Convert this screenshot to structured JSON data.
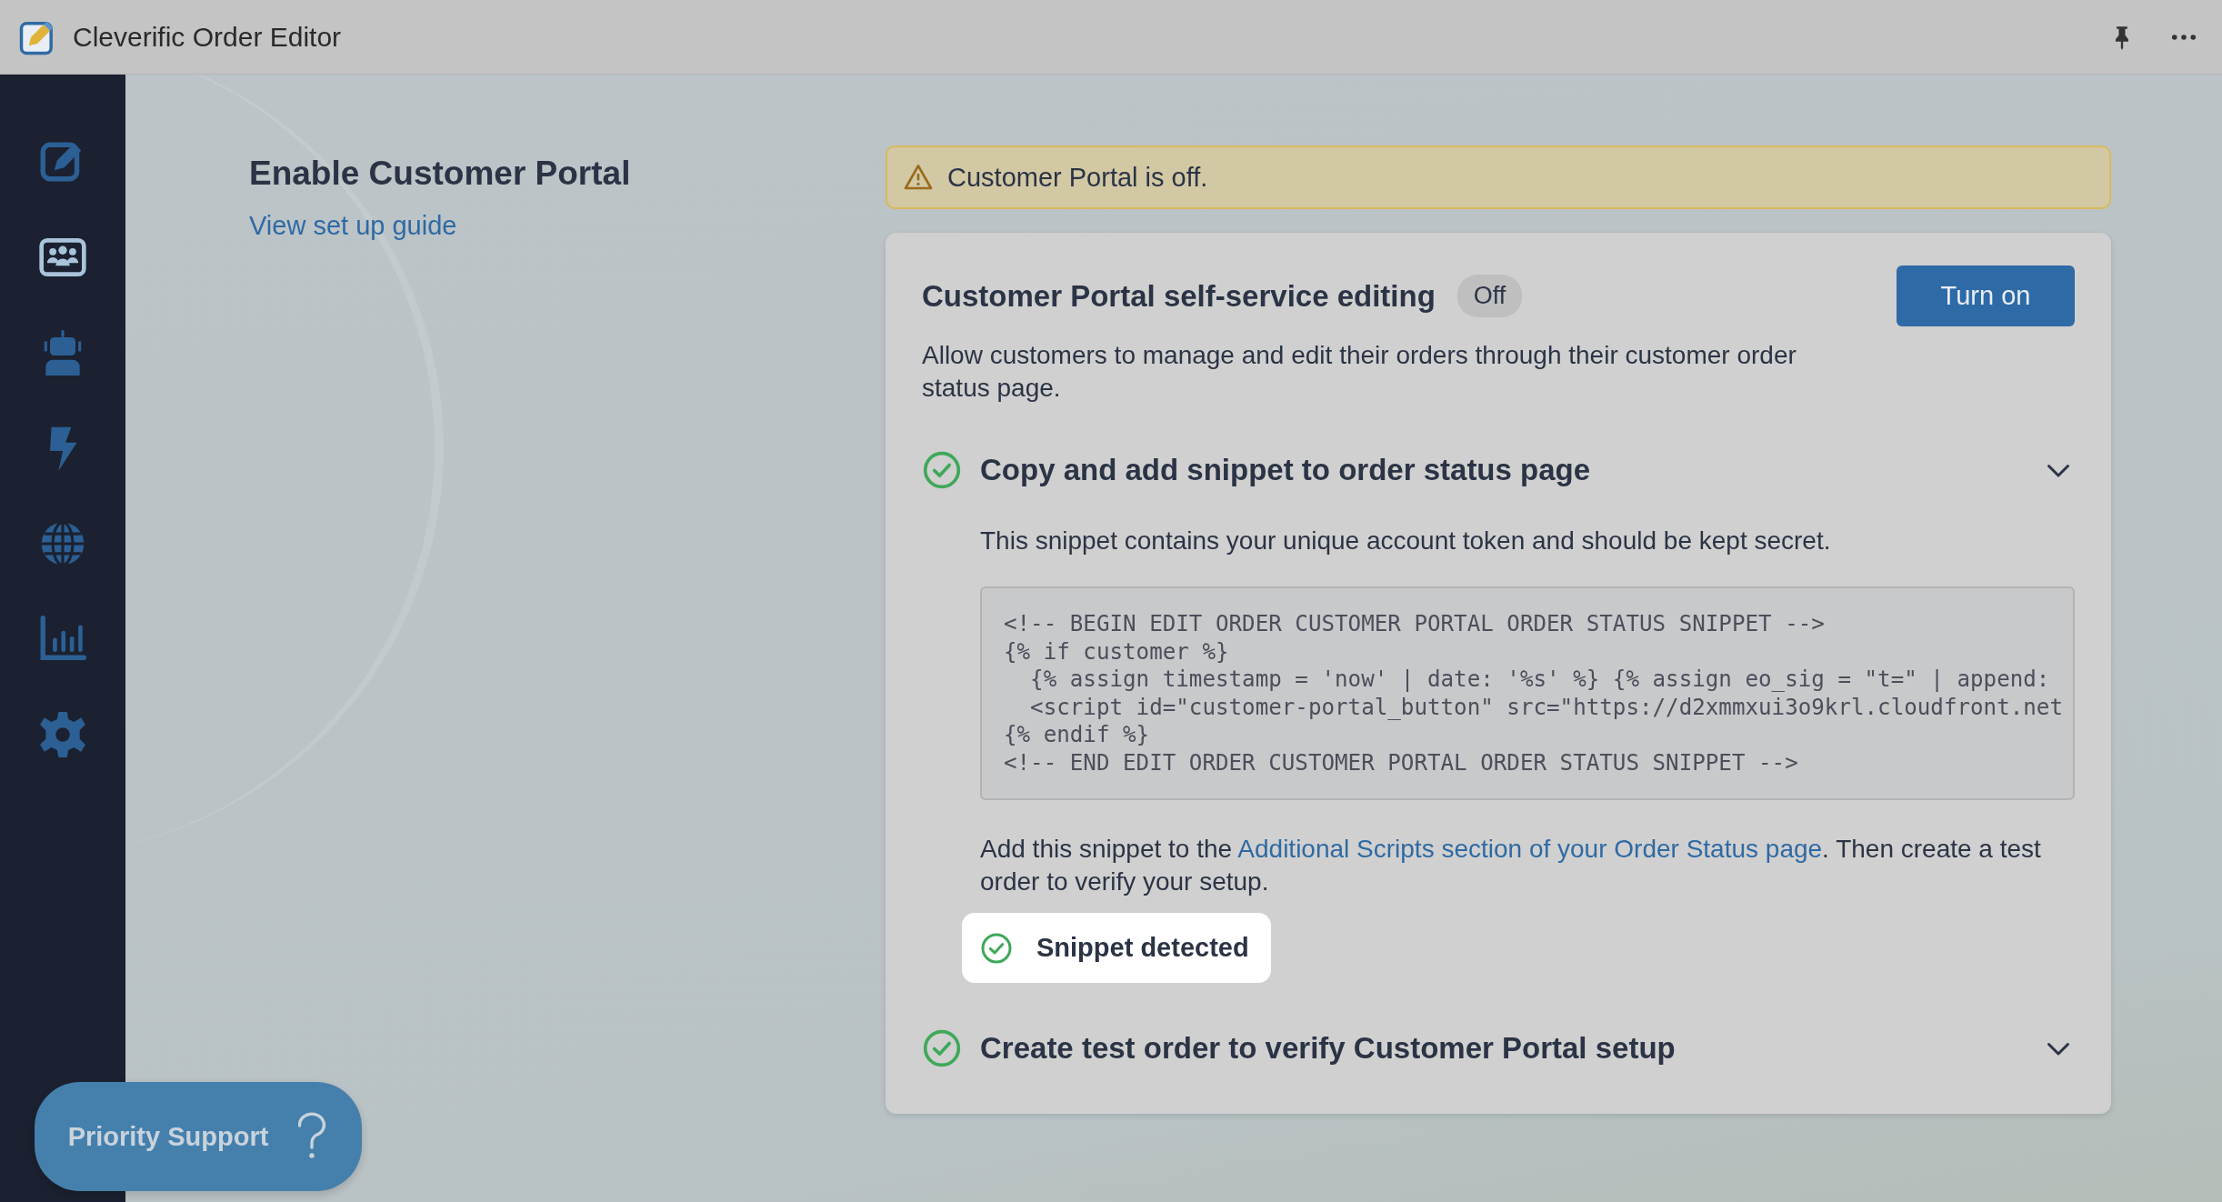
{
  "window": {
    "title": "Cleverific Order Editor"
  },
  "sidebar": {
    "items": [
      {
        "kind": "edit",
        "selected": false
      },
      {
        "kind": "customers",
        "selected": true
      },
      {
        "kind": "robot",
        "selected": false
      },
      {
        "kind": "bolt",
        "selected": false
      },
      {
        "kind": "globe",
        "selected": false
      },
      {
        "kind": "chart",
        "selected": false
      },
      {
        "kind": "settings",
        "selected": false
      }
    ]
  },
  "intro": {
    "heading": "Enable Customer Portal",
    "link": "View set up guide"
  },
  "alert": {
    "kind": "warning",
    "text": "Customer Portal is off."
  },
  "card": {
    "title": "Customer Portal self-service editing",
    "status": "Off",
    "button": "Turn on",
    "description": "Allow customers to manage and edit their orders through their customer order status page.",
    "steps": [
      {
        "title": "Copy and add snippet to order status page",
        "done": true,
        "expanded": true,
        "intro": "This snippet contains your unique account token and should be kept secret.",
        "code": [
          "<!-- BEGIN EDIT ORDER CUSTOMER PORTAL ORDER STATUS SNIPPET -->",
          "{% if customer %}",
          "  {% assign timestamp = 'now' | date: '%s' %} {% assign eo_sig = \"t=\" | append:",
          "  <script id=\"customer-portal_button\" src=\"https://d2xmmxui3o9krl.cloudfront.net",
          "{% endif %}",
          "<!-- END EDIT ORDER CUSTOMER PORTAL ORDER STATUS SNIPPET -->"
        ],
        "note_before": "Add this snippet to the ",
        "note_link": "Additional Scripts section of your Order Status page",
        "note_after": ". Then create a test order to verify your setup.",
        "result": "Snippet detected"
      },
      {
        "title": "Create test order to verify Customer Portal setup",
        "done": true,
        "expanded": false
      }
    ]
  },
  "support_button": "Priority Support"
}
